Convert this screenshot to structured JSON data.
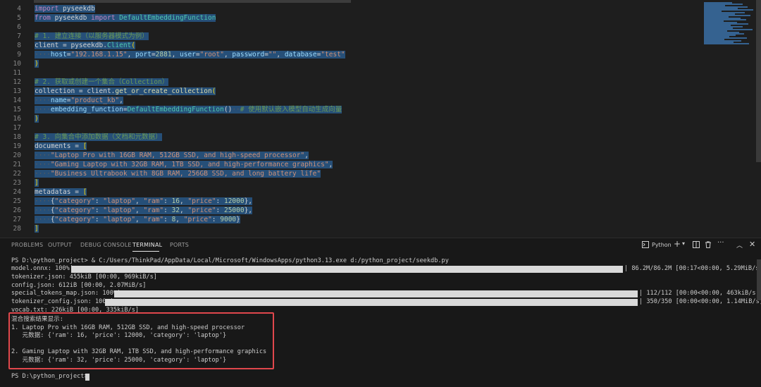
{
  "editor": {
    "lines": [
      {
        "n": "4",
        "html": "<span class=\"sel\"><span class=\"kw\">import</span> pyseekdb</span>"
      },
      {
        "n": "5",
        "html": "<span class=\"sel\"><span class=\"kw\">from</span> pyseekdb <span class=\"kw\">import</span> <span class=\"mod\">DefaultEmbeddingFunction</span></span>"
      },
      {
        "n": "6",
        "html": ""
      },
      {
        "n": "7",
        "html": "<span class=\"sel\"><span class=\"cmt\"># 1. 建立连接（以服务器模式为例）</span></span>"
      },
      {
        "n": "8",
        "html": "<span class=\"sel\">client = pyseekdb.<span class=\"mod\">Client</span><span class=\"br\">(</span></span>"
      },
      {
        "n": "9",
        "html": "<span class=\"sel\"><span class=\"ws\">····</span><span class=\"prm\">host</span>=<span class=\"str\">\"192.168.1.15\"</span>, <span class=\"prm\">port</span>=<span class=\"num\">2881</span>, <span class=\"prm\">user</span>=<span class=\"str\">\"root\"</span>, <span class=\"prm\">password</span>=<span class=\"str\">\"\"</span>, <span class=\"prm\">database</span>=<span class=\"str\">\"test\"</span></span>"
      },
      {
        "n": "10",
        "html": "<span class=\"sel\"><span class=\"br\">)</span></span>"
      },
      {
        "n": "11",
        "html": ""
      },
      {
        "n": "12",
        "html": "<span class=\"sel\"><span class=\"cmt\"># 2. 获取或创建一个集合（Collection）</span></span>"
      },
      {
        "n": "13",
        "html": "<span class=\"sel\">collection = client.<span class=\"fn\">get_or_create_collection</span><span class=\"br\">(</span></span>"
      },
      {
        "n": "14",
        "html": "<span class=\"sel\"><span class=\"ws\">····</span><span class=\"prm\">name</span>=<span class=\"str\">\"product_kb\"</span>,</span>"
      },
      {
        "n": "15",
        "html": "<span class=\"sel\"><span class=\"ws\">····</span><span class=\"prm\">embedding_function</span>=<span class=\"mod\">DefaultEmbeddingFunction</span>()<span class=\"ws\">··</span><span class=\"cmt\"># 使用默认嵌入模型自动生成向量</span></span>"
      },
      {
        "n": "16",
        "html": "<span class=\"sel\"><span class=\"br\">)</span></span>"
      },
      {
        "n": "17",
        "html": ""
      },
      {
        "n": "18",
        "html": "<span class=\"sel\"><span class=\"cmt\"># 3. 向集合中添加数据（文档和元数据）</span></span>"
      },
      {
        "n": "19",
        "html": "<span class=\"sel\">documents = <span class=\"br\">[</span></span>"
      },
      {
        "n": "20",
        "html": "<span class=\"sel\"><span class=\"ws\">····</span><span class=\"str\">\"Laptop Pro with 16GB RAM, 512GB SSD, and high-speed processor\"</span>,</span>"
      },
      {
        "n": "21",
        "html": "<span class=\"sel\"><span class=\"ws\">····</span><span class=\"str\">\"Gaming Laptop with 32GB RAM, 1TB SSD, and high-performance graphics\"</span>,</span>"
      },
      {
        "n": "22",
        "html": "<span class=\"sel\"><span class=\"ws\">····</span><span class=\"str\">\"Business Ultrabook with 8GB RAM, 256GB SSD, and long battery life\"</span></span>"
      },
      {
        "n": "23",
        "html": "<span class=\"sel\"><span class=\"br\">]</span></span>"
      },
      {
        "n": "24",
        "html": "<span class=\"sel\">metadatas = <span class=\"br\">[</span></span>"
      },
      {
        "n": "25",
        "html": "<span class=\"sel\"><span class=\"ws\">····</span>{<span class=\"str\">\"category\"</span>: <span class=\"str\">\"laptop\"</span>, <span class=\"str\">\"ram\"</span>: <span class=\"num\">16</span>, <span class=\"str\">\"price\"</span>: <span class=\"num\">12000</span>},</span>"
      },
      {
        "n": "26",
        "html": "<span class=\"sel\"><span class=\"ws\">····</span>{<span class=\"str\">\"category\"</span>: <span class=\"str\">\"laptop\"</span>, <span class=\"str\">\"ram\"</span>: <span class=\"num\">32</span>, <span class=\"str\">\"price\"</span>: <span class=\"num\">25000</span>},</span>"
      },
      {
        "n": "27",
        "html": "<span class=\"sel\"><span class=\"ws\">····</span>{<span class=\"str\">\"category\"</span>: <span class=\"str\">\"laptop\"</span>, <span class=\"str\">\"ram\"</span>: <span class=\"num\">8</span>, <span class=\"str\">\"price\"</span>: <span class=\"num\">9000</span>}</span>"
      },
      {
        "n": "28",
        "html": "<span class=\"sel\"><span class=\"br\">]</span></span>"
      }
    ]
  },
  "panel": {
    "tabs": {
      "problems": "PROBLEMS",
      "output": "OUTPUT",
      "debug": "DEBUG CONSOLE",
      "terminal": "TERMINAL",
      "ports": "PORTS"
    },
    "shell_label": "Python",
    "icons": {
      "terminal": "terminal-icon",
      "add": "plus-icon",
      "dropdown": "chevron-down-icon",
      "split": "split-icon",
      "trash": "trash-icon",
      "more": "ellipsis-icon",
      "maximize": "maximize-icon",
      "close": "close-icon"
    }
  },
  "terminal": {
    "prompt_cmd": "PS D:\\python_project> & ",
    "python_path": "C:/Users/ThinkPad/AppData/Local/Microsoft/WindowsApps/python3.13.exe",
    "script_arg": " d:/python_project/seekdb.py",
    "model_onnx": "model.onnx: 100%|",
    "model_onnx_tail": "| 86.2M/86.2M [00:17<00:00, 5.29MiB/s]",
    "model_onnx_progress": 1.0,
    "tokenizer_json": "tokenizer.json: 455kiB [00:00, 969kiB/s]",
    "config_json": "config.json: 612iB [00:00, 2.07MiB/s]",
    "special_tokens": "special_tokens_map.json: 100%|",
    "special_tokens_tail": "| 112/112 [00:00<00:00, 463kiB/s]",
    "special_tokens_progress": 1.0,
    "tokenizer_config": "tokenizer_config.json: 100%|",
    "tokenizer_config_tail": "| 350/350 [00:00<00:00, 1.14MiB/s]",
    "tokenizer_config_progress": 1.0,
    "vocab_txt": "vocab.txt: 226kiB [00:00, 335kiB/s]",
    "results_header": "混合搜索结果显示:",
    "result1": "1. Laptop Pro with 16GB RAM, 512GB SSD, and high-speed processor",
    "result1_meta": "   元数据: {'ram': 16, 'price': 12000, 'category': 'laptop'}",
    "result2": "2. Gaming Laptop with 32GB RAM, 1TB SSD, and high-performance graphics",
    "result2_meta": "   元数据: {'ram': 32, 'price': 25000, 'category': 'laptop'}",
    "final_prompt": "PS D:\\python_project> "
  }
}
